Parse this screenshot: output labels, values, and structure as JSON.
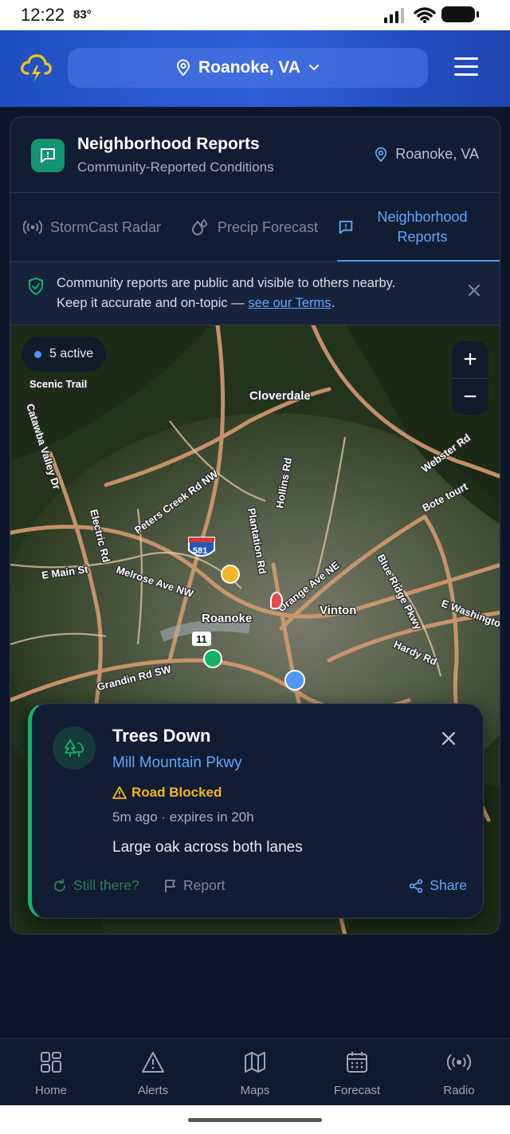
{
  "status_bar": {
    "time": "12:22",
    "temperature": "83°"
  },
  "header": {
    "location": "Roanoke, VA"
  },
  "card": {
    "title": "Neighborhood Reports",
    "subtitle": "Community-Reported Conditions",
    "location": "Roanoke, VA"
  },
  "tabs": [
    {
      "label": "StormCast Radar",
      "active": false
    },
    {
      "label": "Precip Forecast",
      "active": false
    },
    {
      "label": "Neighborhood Reports",
      "active": true
    }
  ],
  "notice": {
    "text_line1": "Community reports are public and visible to others nearby.",
    "text_line2": "Keep it accurate and on-topic — ",
    "terms_link": "see our Terms",
    "text_end": "."
  },
  "map": {
    "active_count_label": "5 active",
    "zoom_in": "+",
    "zoom_out": "−",
    "place_labels": [
      "Cloverdale",
      "Vinton",
      "Roanoke",
      "Scenic Trail",
      "Peters Creek Rd NW",
      "Hollins Rd",
      "Plantation Rd",
      "Orange Ave NE",
      "Melrose Ave NW",
      "E Main St",
      "Grandin Rd SW",
      "Blue Ridge Pkwy",
      "Hardy Rd",
      "Bote tourt",
      "Webster Rd",
      "Catawba Valley Dr",
      "Electric Rd",
      "E Washington",
      "581",
      "11"
    ],
    "markers": [
      {
        "type": "yellow",
        "color": "#f2b824"
      },
      {
        "type": "red",
        "color": "#e5484d"
      },
      {
        "type": "green",
        "color": "#17b26a"
      },
      {
        "type": "blue",
        "color": "#4f97f5"
      }
    ]
  },
  "popup": {
    "title": "Trees Down",
    "location": "Mill Mountain Pkwy",
    "badge": "Road Blocked",
    "time": "5m ago · expires in 20h",
    "description": "Large oak across both lanes",
    "actions": {
      "still_there": "Still there?",
      "report": "Report",
      "share": "Share"
    }
  },
  "bottom_nav": [
    {
      "label": "Home",
      "icon": "grid-icon"
    },
    {
      "label": "Alerts",
      "icon": "warning-icon"
    },
    {
      "label": "Maps",
      "icon": "map-icon"
    },
    {
      "label": "Forecast",
      "icon": "calendar-icon"
    },
    {
      "label": "Radio",
      "icon": "radio-icon"
    }
  ],
  "colors": {
    "accent": "#4f97f5",
    "header": "#2f5fd8",
    "report_green": "#17b26a",
    "warning": "#f2b824"
  }
}
